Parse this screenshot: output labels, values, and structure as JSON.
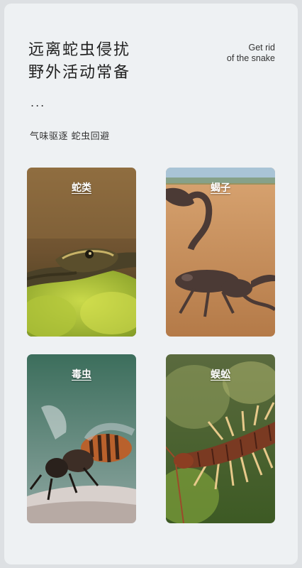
{
  "header": {
    "title_line1": "远离蛇虫侵扰",
    "title_line2": "野外活动常备",
    "en_line1": "Get rid",
    "en_line2": "of the snake",
    "dots": "...",
    "subtitle": "气味驱逐 蛇虫回避"
  },
  "tiles": [
    {
      "label": "蛇类",
      "image": "snake-photo"
    },
    {
      "label": "蝎子",
      "image": "scorpion-photo"
    },
    {
      "label": "毒虫",
      "image": "wasp-photo"
    },
    {
      "label": "蜈蚣",
      "image": "centipede-photo"
    }
  ]
}
